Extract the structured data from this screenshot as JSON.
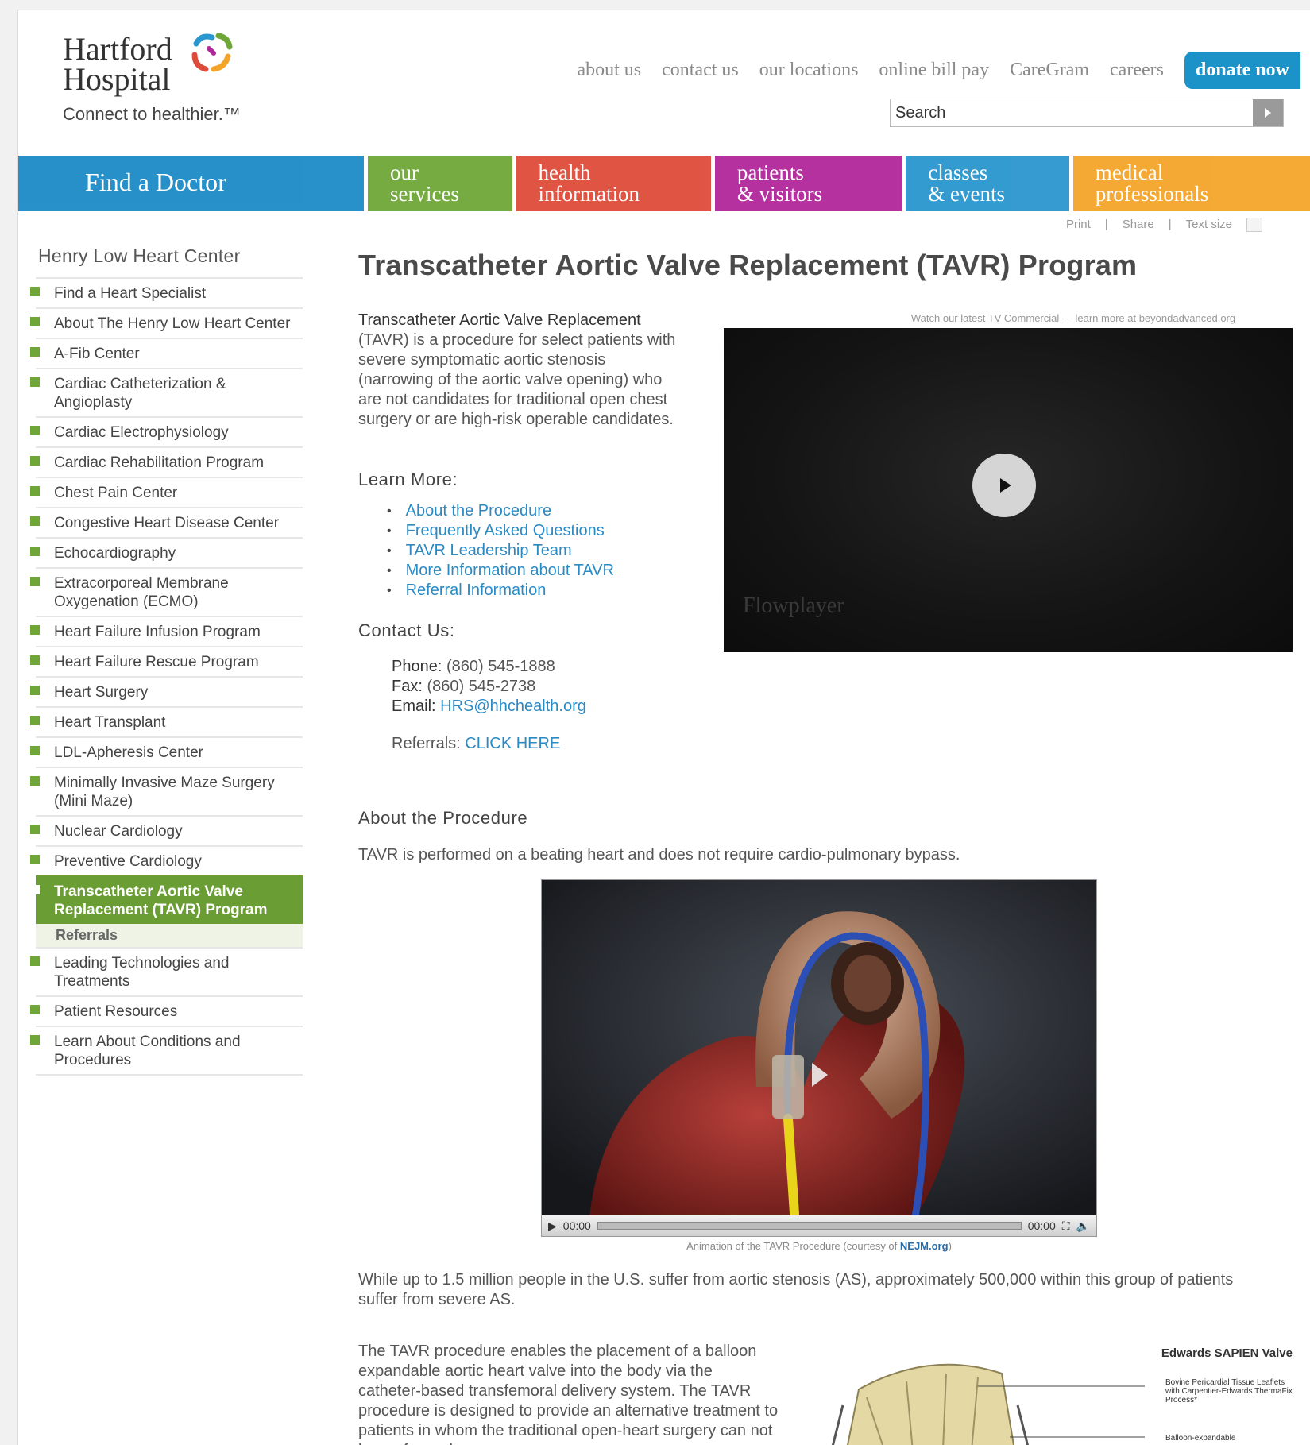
{
  "logo": {
    "line1": "Hartford",
    "line2": "Hospital",
    "tagline": "Connect to healthier.™"
  },
  "utility_nav": [
    "about us",
    "contact us",
    "our locations",
    "online bill pay",
    "CareGram",
    "careers"
  ],
  "donate_label": "donate now",
  "search": {
    "placeholder": "Search",
    "value": "Search"
  },
  "main_nav": [
    {
      "label": "Find a Doctor",
      "color": "#1c8bc6"
    },
    {
      "label": "our\nservices",
      "color": "#6ea737"
    },
    {
      "label": "health\ninformation",
      "color": "#df4b3b"
    },
    {
      "label": "patients\n& visitors",
      "color": "#b0279a"
    },
    {
      "label": "classes\n& events",
      "color": "#2a96ce"
    },
    {
      "label": "medical\nprofessionals",
      "color": "#f3a52a"
    }
  ],
  "page_tools": {
    "print": "Print",
    "share": "Share",
    "text_size": "Text size"
  },
  "sidebar": {
    "title": "Henry Low Heart Center",
    "items": [
      "Find a Heart Specialist",
      "About The Henry Low Heart Center",
      "A-Fib Center",
      "Cardiac Catheterization & Angioplasty",
      "Cardiac Electrophysiology",
      "Cardiac Rehabilitation Program",
      "Chest Pain Center",
      "Congestive Heart Disease Center",
      "Echocardiography",
      "Extracorporeal Membrane Oxygenation (ECMO)",
      "Heart Failure Infusion Program",
      "Heart Failure Rescue Program",
      "Heart Surgery",
      "Heart Transplant",
      "LDL-Apheresis Center",
      "Minimally Invasive Maze Surgery (Mini Maze)",
      "Nuclear Cardiology",
      "Preventive Cardiology",
      "Transcatheter Aortic Valve Replacement (TAVR) Program"
    ],
    "active_index": 18,
    "subitem": "Referrals",
    "items_after": [
      "Leading Technologies and Treatments",
      "Patient Resources",
      "Learn About Conditions and Procedures"
    ]
  },
  "main": {
    "title": "Transcatheter Aortic Valve Replacement (TAVR) Program",
    "intro_lead": "Transcatheter Aortic Valve Replacement",
    "intro_rest": " (TAVR) is a procedure for select patients with severe symptomatic aortic stenosis (narrowing of the aortic valve opening) who are not candidates for traditional open chest surgery or are high-risk operable candidates.",
    "learn_more_heading": "Learn More:",
    "learn_more_links": [
      "About the Procedure",
      "Frequently Asked Questions",
      "TAVR Leadership Team",
      "More Information about TAVR",
      "Referral Information"
    ],
    "contact_heading": "Contact Us:",
    "contact": {
      "phone_label": "Phone:",
      "phone": "(860) 545-1888",
      "fax_label": "Fax:",
      "fax": "(860) 545-2738",
      "email_label": "Email:",
      "email": "HRS@hhchealth.org",
      "referrals_label": "Referrals:",
      "referrals_link": "CLICK HERE"
    },
    "video1_caption": "Watch our latest TV Commercial — learn more at beyondadvanced.org",
    "video1_brand": "Flowplayer",
    "about_heading": "About the Procedure",
    "about_text": "TAVR is performed on a beating heart and does not require cardio-pulmonary bypass.",
    "video2_time_current": "00:00",
    "video2_time_total": "00:00",
    "video2_caption_pre": "Animation of the TAVR Procedure (courtesy of ",
    "video2_caption_link": "NEJM.org",
    "video2_caption_post": ")",
    "stat_text": "While up to 1.5 million people in the U.S. suffer from aortic stenosis (AS), approximately 500,000 within this group of patients suffer from severe AS.",
    "tavr_text": "The TAVR procedure enables the placement of a balloon expandable aortic heart valve into the body via the catheter-based transfemoral delivery system. The TAVR procedure is designed to provide an alternative treatment to patients in whom the traditional open-heart surgery can not be performed.",
    "valve_title": "Edwards SAPIEN Valve",
    "valve_label1": "Bovine Pericardial Tissue Leaflets with Carpentier-Edwards ThermaFix Process*",
    "valve_label2": "Balloon-expandable"
  }
}
